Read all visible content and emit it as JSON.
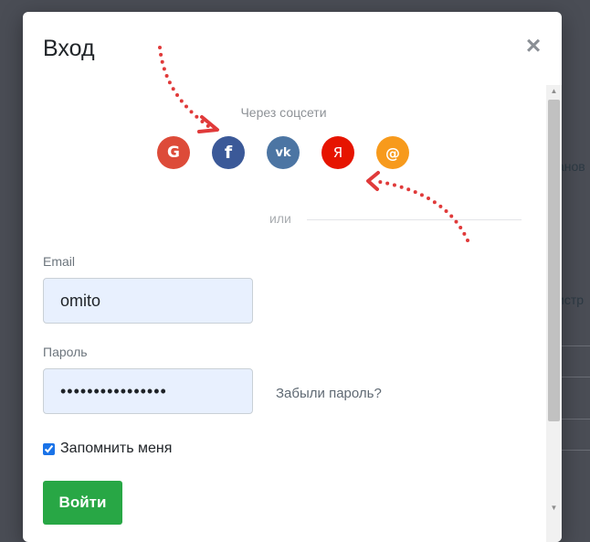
{
  "modal": {
    "title": "Вход",
    "close_symbol": "×"
  },
  "social": {
    "caption": "Через соцсети",
    "buttons": [
      {
        "id": "google",
        "glyph": "G",
        "color": "#dd4b39",
        "icon": "google-icon"
      },
      {
        "id": "facebook",
        "glyph": "f",
        "color": "#3b5998",
        "icon": "facebook-icon"
      },
      {
        "id": "vk",
        "glyph": "vk",
        "color": "#4c75a3",
        "icon": "vk-icon"
      },
      {
        "id": "yandex",
        "glyph": "Я",
        "color": "#e61400",
        "icon": "yandex-icon"
      },
      {
        "id": "mailru",
        "glyph": "@",
        "color": "#f79a1c",
        "icon": "mailru-icon"
      }
    ]
  },
  "divider": {
    "text": "или"
  },
  "form": {
    "email_label": "Email",
    "email_value": "omito",
    "password_label": "Пароль",
    "password_value": "••••••••••••••••",
    "forgot_link": "Забыли пароль?",
    "remember_label": "Запомнить меня",
    "remember_checked": true,
    "submit_label": "Войти"
  },
  "background": {
    "fragment_1": "анов",
    "fragment_2": "истр"
  },
  "colors": {
    "accent_green": "#28a745",
    "annotation_red": "#e03a3a",
    "input_fill": "#e8f0fe"
  }
}
